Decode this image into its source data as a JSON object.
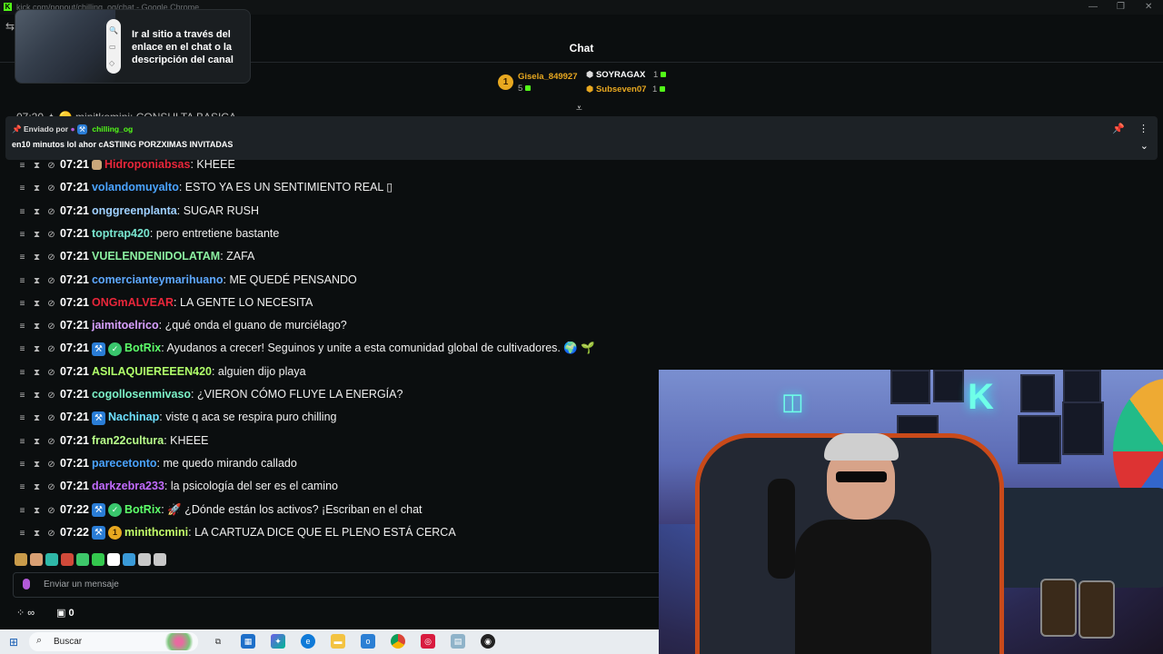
{
  "window": {
    "title": "kick.com/popout/chilling_og/chat - Google Chrome"
  },
  "header": {
    "title": "Chat"
  },
  "tooltip": {
    "text": "Ir al sitio a través del enlace en el chat o la descripción del canal"
  },
  "leaderboard": [
    {
      "rank": "1",
      "name": "Gisela_849927",
      "count": "5",
      "color": "#e8a820"
    },
    {
      "name": "SOYRAGAX",
      "count": "1",
      "color": "#ffffff"
    },
    {
      "name": "Subseven07",
      "count": "1",
      "color": "#e8a820"
    }
  ],
  "pinned": {
    "sent_by_label": "Enviado por",
    "author": "chilling_og",
    "message": "en10 minutos lol ahor cASTIING PORZXIMAS INVITADAS"
  },
  "peek_message": "07:20 ✦ 🟡 minitkomini: CONSULTA BASICA",
  "messages": [
    {
      "time": "07:21",
      "badges": [
        "tan"
      ],
      "user": "Hidroponiabsas",
      "color": "#e8263a",
      "text": "KHEEE"
    },
    {
      "time": "07:21",
      "badges": [],
      "user": "volandomuyalto",
      "color": "#4aa3ff",
      "text": "ESTO YA ES UN SENTIMIENTO REAL ▯"
    },
    {
      "time": "07:21",
      "badges": [],
      "user": "onggreenplanta",
      "color": "#9fd0ff",
      "text": "SUGAR RUSH"
    },
    {
      "time": "07:21",
      "badges": [],
      "user": "toptrap420",
      "color": "#79e6d0",
      "text": "pero entretiene bastante"
    },
    {
      "time": "07:21",
      "badges": [],
      "user": "VUELENDENIDOLATAM",
      "color": "#8bf0a0",
      "text": "ZAFA"
    },
    {
      "time": "07:21",
      "badges": [],
      "user": "comercianteymarihuano",
      "color": "#5ea8ff",
      "text": "ME QUEDÉ PENSANDO"
    },
    {
      "time": "07:21",
      "badges": [],
      "user": "ONGmALVEAR",
      "color": "#e8263a",
      "text": "LA GENTE LO NECESITA"
    },
    {
      "time": "07:21",
      "badges": [],
      "user": "jaimitoelrico",
      "color": "#d8a0ff",
      "text": "¿qué onda el guano de murciélago?"
    },
    {
      "time": "07:21",
      "badges": [
        "blue",
        "green"
      ],
      "user": "BotRix",
      "color": "#5dff6a",
      "text": "Ayudanos a crecer! Seguinos y unite a esta comunidad global de cultivadores. 🌍 🌱"
    },
    {
      "time": "07:21",
      "badges": [],
      "user": "ASILAQUIEREEEN420",
      "color": "#b0ff6a",
      "text": "alguien dijo playa"
    },
    {
      "time": "07:21",
      "badges": [],
      "user": "cogollosenmivaso",
      "color": "#7cf2c8",
      "text": "¿VIERON CÓMO FLUYE LA ENERGÍA?"
    },
    {
      "time": "07:21",
      "badges": [
        "blue"
      ],
      "user": "Nachinap",
      "color": "#6ee0ff",
      "text": "viste q aca se respira puro chilling"
    },
    {
      "time": "07:21",
      "badges": [],
      "user": "fran22cultura",
      "color": "#b8ff8a",
      "text": "KHEEE"
    },
    {
      "time": "07:21",
      "badges": [],
      "user": "parecetonto",
      "color": "#4aa3ff",
      "text": "me quedo mirando callado"
    },
    {
      "time": "07:21",
      "badges": [],
      "user": "darkzebra233",
      "color": "#c26bff",
      "text": "la psicología del ser es el camino"
    },
    {
      "time": "07:22",
      "badges": [
        "blue",
        "green"
      ],
      "user": "BotRix",
      "color": "#5dff6a",
      "text": "🚀 ¿Dónde están los activos? ¡Escriban en el chat"
    },
    {
      "time": "07:22",
      "badges": [
        "blue",
        "gold"
      ],
      "user": "minithcmini",
      "color": "#c4ff6a",
      "text": "LA CARTUZA DICE QUE EL PLENO ESTÁ CERCA"
    }
  ],
  "emotes": [
    "#c99b4a",
    "#d9a074",
    "#2fb8a8",
    "#d14a3a",
    "#3ec76a",
    "#34c84e",
    "#ffffff",
    "#3a9ad8",
    "#c8c8c8",
    "#c8c8c8"
  ],
  "input": {
    "placeholder": "Enviar un mensaje"
  },
  "controls": {
    "points_icon": "∞",
    "chest_count": "0"
  },
  "taskbar": {
    "search_label": "Buscar"
  }
}
